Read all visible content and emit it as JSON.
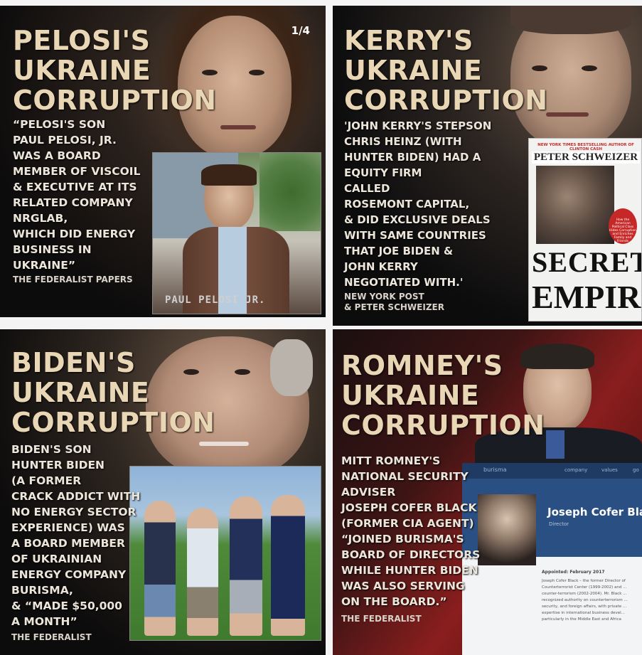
{
  "panels": [
    {
      "id": "pelosi",
      "title": [
        "PELOSI'S",
        "UKRAINE",
        "CORRUPTION"
      ],
      "counter": "1/4",
      "body": [
        "“PELOSI'S SON",
        "PAUL PELOSI, JR.",
        "WAS A BOARD",
        "MEMBER OF VISCOIL",
        "& EXECUTIVE AT ITS",
        "RELATED COMPANY",
        "NRGLAB,",
        "WHICH DID ENERGY",
        "BUSINESS IN",
        "UKRAINE”"
      ],
      "source": [
        "THE FEDERALIST PAPERS"
      ],
      "image_caption": "PAUL PELOSI JR."
    },
    {
      "id": "kerry",
      "title": [
        "KERRY'S",
        "UKRAINE",
        "CORRUPTION"
      ],
      "body": [
        "'JOHN KERRY'S STEPSON",
        "CHRIS HEINZ (WITH",
        "HUNTER BIDEN) HAD A",
        "EQUITY FIRM",
        "CALLED",
        "ROSEMONT CAPITAL,",
        "& DID EXCLUSIVE DEALS",
        "WITH SAME COUNTRIES",
        "THAT JOE BIDEN &",
        "JOHN KERRY",
        "NEGOTIATED WITH.'"
      ],
      "source": [
        "NEW YORK POST",
        "& PETER SCHWEIZER"
      ],
      "book": {
        "blurb": "NEW YORK TIMES BESTSELLING AUTHOR OF CLINTON CASH",
        "author": "PETER SCHWEIZER",
        "sticker": "How the American Political Class Hides Corruption and Enriches Family and Friends",
        "title_1": "SECRET",
        "title_2": "EMPIRES"
      }
    },
    {
      "id": "biden",
      "title": [
        "BIDEN'S",
        "UKRAINE",
        "CORRUPTION"
      ],
      "body": [
        "BIDEN'S SON",
        "HUNTER BIDEN",
        "(A FORMER",
        "CRACK ADDICT WITH",
        "NO ENERGY SECTOR",
        "EXPERIENCE) WAS",
        "A BOARD MEMBER",
        "OF UKRAINIAN",
        "ENERGY COMPANY",
        "BURISMA,",
        "& “MADE $50,000",
        "A MONTH”"
      ],
      "source": [
        "THE FEDERALIST"
      ]
    },
    {
      "id": "romney",
      "title": [
        "ROMNEY'S",
        "UKRAINE",
        "CORRUPTION"
      ],
      "body": [
        "MITT ROMNEY'S",
        "NATIONAL SECURITY",
        "ADVISER",
        "JOSEPH COFER BLACK",
        "(FORMER CIA AGENT)",
        "“JOINED BURISMA'S",
        "BOARD OF DIRECTORS",
        "WHILE HUNTER BIDEN",
        "WAS ALSO SERVING",
        "ON THE BOARD.”"
      ],
      "source": [
        "THE FEDERALIST"
      ],
      "card": {
        "brand": "burisma",
        "nav": [
          "company",
          "values",
          "go"
        ],
        "name": "Joseph Cofer Bla",
        "role": "Director",
        "appointed": "Appointed: February 2017",
        "text": "Joseph Cofer Black – the former Director of Counterterrorist Center (1999-2002) and ... counter-terrorism (2002-2004). Mr. Black ... recognized authority on counterterrorism ... security, and foreign affairs, with private ... expertise in international business devel... particularly in the Middle East and Africa"
      }
    }
  ]
}
